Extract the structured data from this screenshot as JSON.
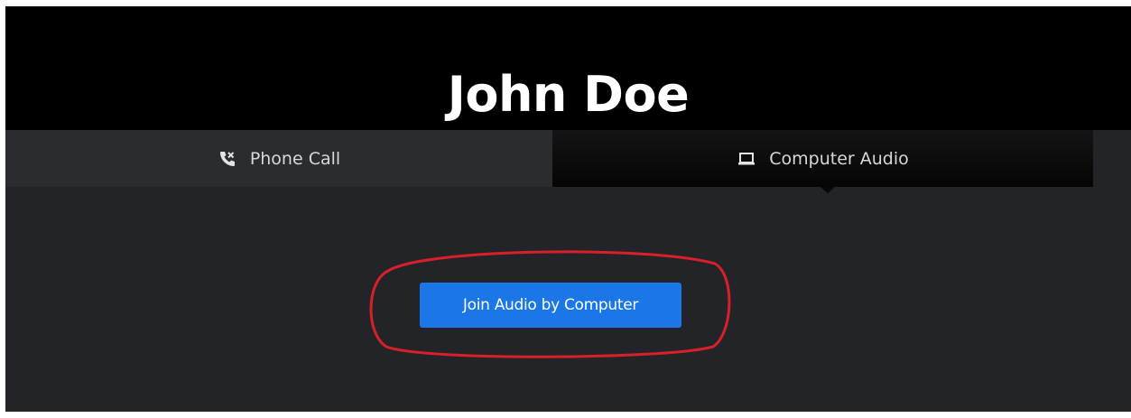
{
  "header": {
    "title": "John Doe"
  },
  "tabs": {
    "phone_call": {
      "label": "Phone Call",
      "icon": "phone-icon"
    },
    "computer_audio": {
      "label": "Computer Audio",
      "icon": "laptop-icon",
      "selected": true
    }
  },
  "main": {
    "join_button_label": "Join Audio by Computer"
  },
  "colors": {
    "header_bg": "#000000",
    "panel_bg": "#232427",
    "button_blue": "#1b76e8",
    "annotation_red": "#d8202a"
  }
}
